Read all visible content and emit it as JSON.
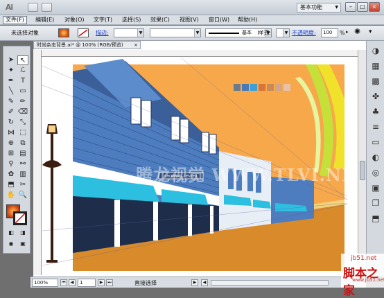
{
  "app": {
    "logo": "Ai",
    "workspace": "基本功能"
  },
  "menu": [
    "文件(F)",
    "编辑(E)",
    "对象(O)",
    "文字(T)",
    "选择(S)",
    "效果(C)",
    "视图(V)",
    "窗口(W)",
    "帮助(H)"
  ],
  "control": {
    "selection": "未选择对象",
    "stroke_label": "描边:",
    "stroke_style": "基本",
    "style_label": "样式:",
    "opacity_label": "不透明度:",
    "opacity_value": "100",
    "opacity_unit": "%"
  },
  "document": {
    "tab": "时尚杂志背景.ai* @ 100% (RGB/预览)"
  },
  "status": {
    "zoom": "100%",
    "page": "1",
    "tool": "直接选择"
  },
  "canvas": {
    "sign": "SHOPPING CENTER",
    "watermark": "腾龙视觉 WWW.TLVI.NET"
  },
  "corner": {
    "line1": "jb51.net",
    "line2": "脚本之家",
    "line3": "www.jb51.net"
  },
  "colors": {
    "sky": "#f7a84a",
    "building": "#4d7dbf",
    "awning": "#2cbfe0",
    "street": "#d98a2a",
    "palette": [
      "#6c7a8c",
      "#4b78b8",
      "#3aa0d8",
      "#d7743a",
      "#c98a55",
      "#d2a48a",
      "#e8c2a8"
    ]
  }
}
